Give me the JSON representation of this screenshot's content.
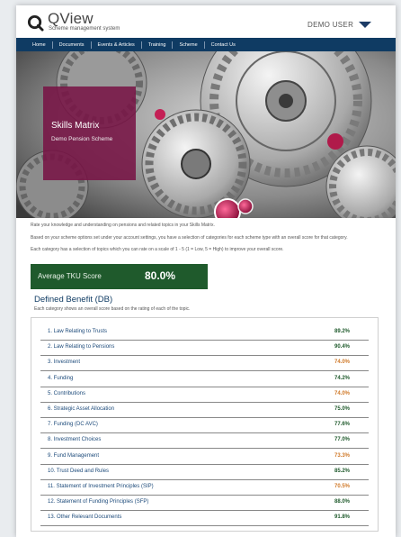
{
  "brand": {
    "title": "QView",
    "subtitle": "Scheme management system"
  },
  "user": {
    "name": "DEMO USER"
  },
  "nav": [
    {
      "label": "Home"
    },
    {
      "label": "Documents"
    },
    {
      "label": "Events & Articles"
    },
    {
      "label": "Training"
    },
    {
      "label": "Scheme"
    },
    {
      "label": "Contact Us"
    }
  ],
  "hero": {
    "title": "Skills Matrix",
    "subtitle": "Demo Pension Scheme"
  },
  "intro": [
    "Rate your knowledge and understanding on pensions and related topics in your Skills Matrix.",
    "Based on your scheme options set under your account settings, you have a selection of categories for each scheme type with an overall score for that category.",
    "Each category has a selection of topics which you can rate on a scale of 1 - 5 (1 = Low, 5 = High) to improve your overall score."
  ],
  "tku": {
    "label": "Average TKU Score",
    "value": "80.0%"
  },
  "section": {
    "title": "Defined Benefit (DB)",
    "description": "Each category shows an overall score based on the rating of each of the topic."
  },
  "colors": {
    "high": "#1f5a2c",
    "medium": "#d07a2a",
    "navy": "#0f3b63"
  },
  "categories": [
    {
      "label": "1. Law Relating to Trusts",
      "score": "89.2%",
      "level": "high"
    },
    {
      "label": "2. Law Relating to Pensions",
      "score": "90.4%",
      "level": "high"
    },
    {
      "label": "3. Investment",
      "score": "74.0%",
      "level": "medium"
    },
    {
      "label": "4. Funding",
      "score": "74.2%",
      "level": "high"
    },
    {
      "label": "5. Contributions",
      "score": "74.0%",
      "level": "medium"
    },
    {
      "label": "6. Strategic Asset Allocation",
      "score": "75.0%",
      "level": "high"
    },
    {
      "label": "7. Funding (DC AVC)",
      "score": "77.6%",
      "level": "high"
    },
    {
      "label": "8. Investment Choices",
      "score": "77.0%",
      "level": "high"
    },
    {
      "label": "9. Fund Management",
      "score": "73.3%",
      "level": "medium"
    },
    {
      "label": "10. Trust Deed and Rules",
      "score": "85.2%",
      "level": "high"
    },
    {
      "label": "11. Statement of Investment Principles (SIP)",
      "score": "70.5%",
      "level": "medium"
    },
    {
      "label": "12. Statement of Funding Principles (SFP)",
      "score": "88.0%",
      "level": "high"
    },
    {
      "label": "13. Other Relevant Documents",
      "score": "91.8%",
      "level": "high"
    }
  ]
}
